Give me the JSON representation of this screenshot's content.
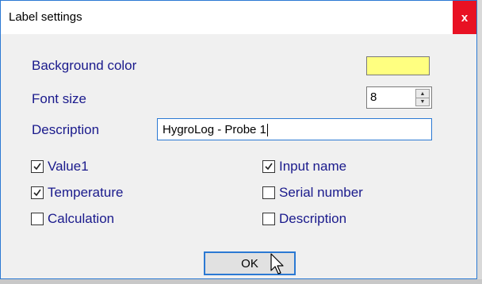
{
  "window": {
    "title": "Label settings",
    "close_label": "x"
  },
  "fields": {
    "background_color_label": "Background color",
    "background_color_value": "#ffff80",
    "font_size_label": "Font size",
    "font_size_value": "8",
    "description_label": "Description",
    "description_value": "HygroLog - Probe 1"
  },
  "checkboxes": [
    {
      "label": "Value1",
      "checked": true
    },
    {
      "label": "Temperature",
      "checked": true
    },
    {
      "label": "Calculation",
      "checked": false
    },
    {
      "label": "Input name",
      "checked": true
    },
    {
      "label": "Serial number",
      "checked": false
    },
    {
      "label": "Description",
      "checked": false
    }
  ],
  "buttons": {
    "ok_label": "OK"
  },
  "colors": {
    "accent": "#2b79d3",
    "label_text": "#1a1a8c",
    "close_bg": "#e81123"
  }
}
